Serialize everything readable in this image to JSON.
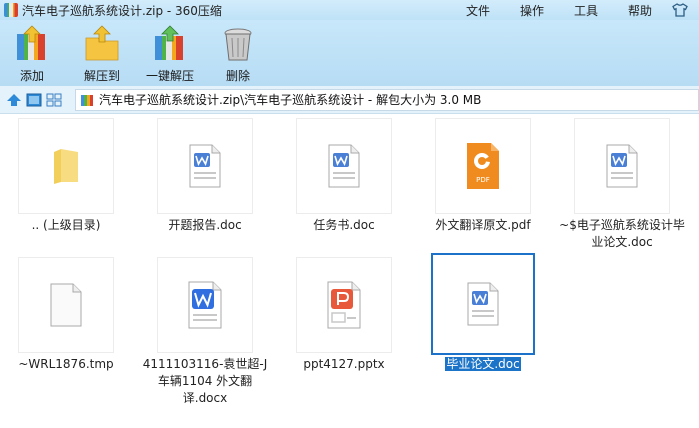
{
  "window": {
    "title": "汽车电子巡航系统设计.zip - 360压缩"
  },
  "menu": {
    "items": [
      "文件",
      "操作",
      "工具",
      "帮助"
    ],
    "skin_icon": "tshirt-icon"
  },
  "toolbar": {
    "buttons": [
      {
        "label": "添加",
        "icon": "add-archive-icon"
      },
      {
        "label": "解压到",
        "icon": "extract-to-icon"
      },
      {
        "label": "一键解压",
        "icon": "one-click-extract-icon"
      },
      {
        "label": "删除",
        "icon": "trash-icon"
      }
    ]
  },
  "address": {
    "path": "汽车电子巡航系统设计.zip\\汽车电子巡航系统设计 - 解包大小为 3.0 MB"
  },
  "files": [
    {
      "name": ".. (上级目录)",
      "type": "folder"
    },
    {
      "name": "开题报告.doc",
      "type": "word"
    },
    {
      "name": "任务书.doc",
      "type": "word"
    },
    {
      "name": "外文翻译原文.pdf",
      "type": "pdf"
    },
    {
      "name": "~$电子巡航系统设计毕业论文.doc",
      "type": "word"
    },
    {
      "name": "~WRL1876.tmp",
      "type": "blank"
    },
    {
      "name": "4111103116-袁世超-J车辆1104 外文翻译.docx",
      "type": "word-blue"
    },
    {
      "name": "ppt4127.pptx",
      "type": "ppt"
    },
    {
      "name": "毕业论文.doc",
      "type": "word",
      "selected": true
    }
  ],
  "colors": {
    "selection": "#1c74c9",
    "toolbar": "#bfe2f7",
    "pdf": "#f08c1f",
    "ppt": "#e8593b",
    "word": "#3b6fd1"
  }
}
